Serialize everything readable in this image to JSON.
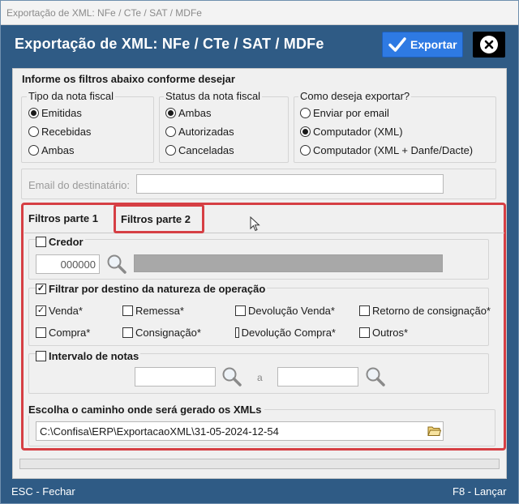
{
  "window": {
    "title": "Exportação de XML: NFe / CTe / SAT / MDFe"
  },
  "header": {
    "title": "Exportação de XML: NFe / CTe / SAT / MDFe",
    "export_label": "Exportar"
  },
  "filters": {
    "heading": "Informe os filtros abaixo conforme desejar",
    "tipo": {
      "legend": "Tipo da nota fiscal",
      "options": [
        "Emitidas",
        "Recebidas",
        "Ambas"
      ],
      "selected": "Emitidas"
    },
    "status": {
      "legend": "Status da nota fiscal",
      "options": [
        "Ambas",
        "Autorizadas",
        "Canceladas"
      ],
      "selected": "Ambas"
    },
    "exportar": {
      "legend": "Como deseja exportar?",
      "options": [
        "Enviar por email",
        "Computador (XML)",
        "Computador (XML + Danfe/Dacte)"
      ],
      "selected": "Computador (XML)"
    },
    "email": {
      "label": "Email do destinatário:",
      "value": ""
    }
  },
  "tabs": [
    {
      "label": "Filtros parte 1",
      "active": true
    },
    {
      "label": "Filtros parte 2",
      "active": false
    }
  ],
  "credor": {
    "label": "Credor",
    "checked": false,
    "code": "000000",
    "name": ""
  },
  "natureza": {
    "label": "Filtrar por destino da natureza de operação",
    "checked": true,
    "items": [
      {
        "label": "Venda*",
        "checked": true
      },
      {
        "label": "Remessa*",
        "checked": false
      },
      {
        "label": "Devolução Venda*",
        "checked": false
      },
      {
        "label": "Retorno de consignação*",
        "checked": false
      },
      {
        "label": "Compra*",
        "checked": false
      },
      {
        "label": "Consignação*",
        "checked": false
      },
      {
        "label": "Devolução Compra*",
        "checked": false
      },
      {
        "label": "Outros*",
        "checked": false
      }
    ]
  },
  "intervalo": {
    "label": "Intervalo de notas",
    "checked": false,
    "from": "",
    "separator": "a",
    "to": ""
  },
  "caminho": {
    "label": "Escolha o caminho onde será gerado os XMLs",
    "path": "C:\\Confisa\\ERP\\ExportacaoXML\\31-05-2024-12-54"
  },
  "progress": {
    "fraction": 0
  },
  "footer": {
    "left": "ESC - Fechar",
    "right": "F8 - Lançar"
  },
  "colors": {
    "accent": "#2e7ae3",
    "header_bg": "#2f5b85",
    "highlight": "#d63f44"
  },
  "icons": [
    "check-icon",
    "close-icon",
    "search-icon",
    "folder-icon",
    "mouse-cursor-icon"
  ]
}
